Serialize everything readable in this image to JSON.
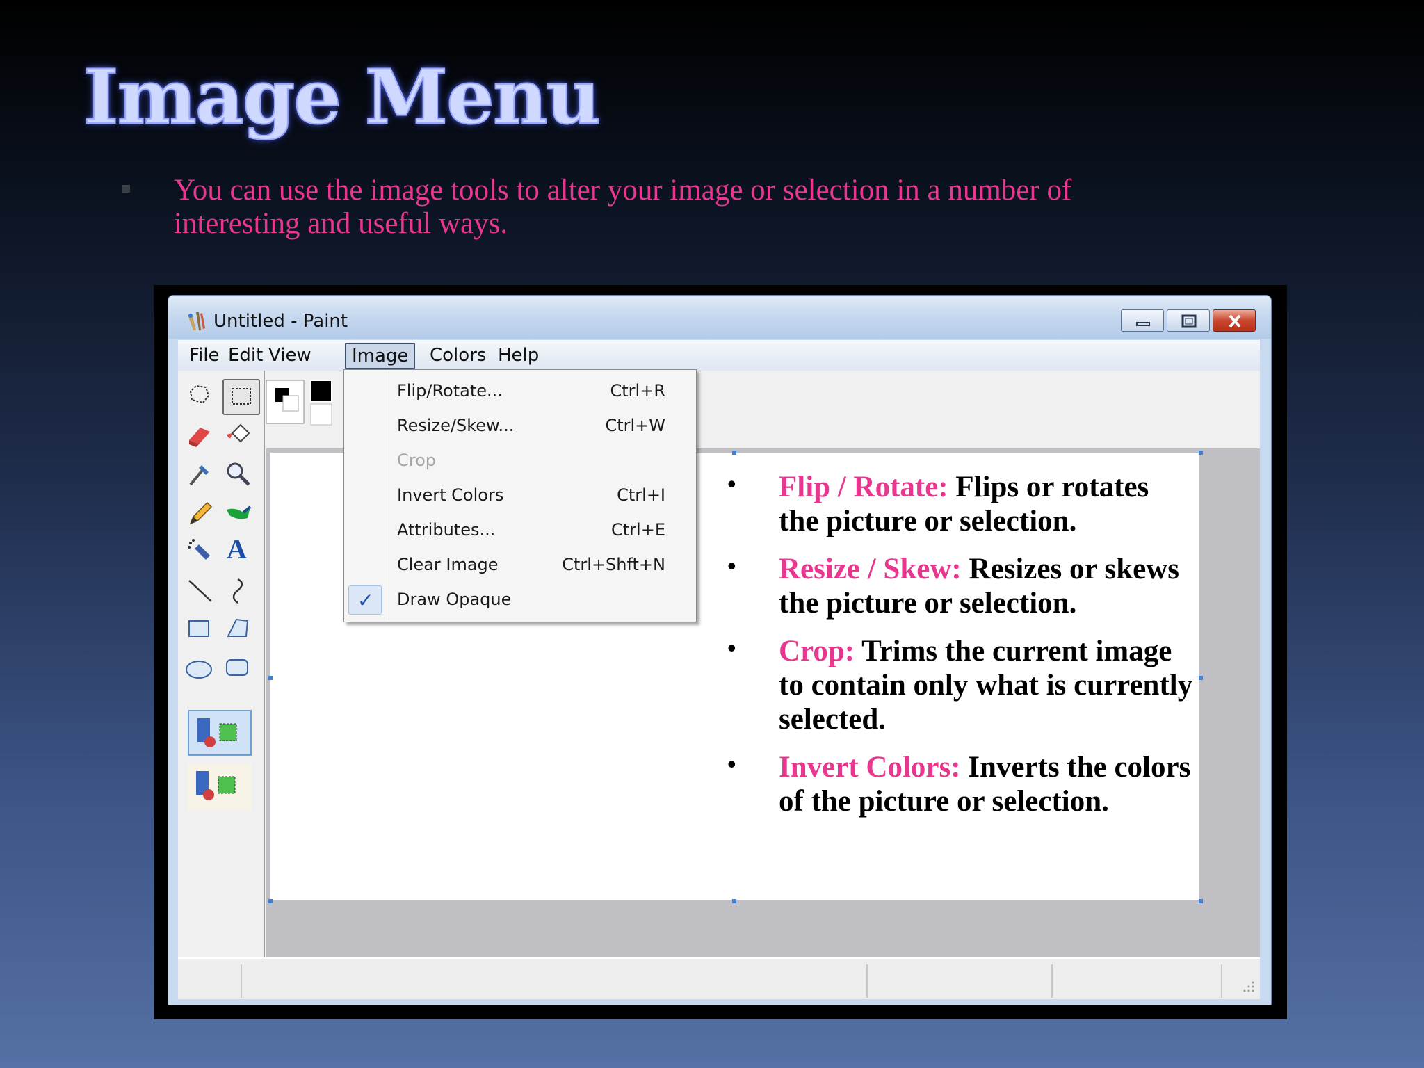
{
  "slide": {
    "title": "Image Menu",
    "intro": "You can use the image tools to alter your image or selection in a number of interesting and useful ways."
  },
  "window": {
    "title": "Untitled - Paint",
    "buttons": {
      "minimize": "minimize",
      "maximize": "maximize",
      "close": "close"
    }
  },
  "menubar": {
    "items": [
      {
        "label": "File"
      },
      {
        "label": "Edit"
      },
      {
        "label": "View"
      },
      {
        "label": "Image"
      },
      {
        "label": "Colors"
      },
      {
        "label": "Help"
      }
    ],
    "active": "Image"
  },
  "dropdown": {
    "items": [
      {
        "label": "Flip/Rotate...",
        "shortcut": "Ctrl+R",
        "enabled": true
      },
      {
        "label": "Resize/Skew...",
        "shortcut": "Ctrl+W",
        "enabled": true
      },
      {
        "label": "Crop",
        "shortcut": "",
        "enabled": false
      },
      {
        "label": "Invert Colors",
        "shortcut": "Ctrl+I",
        "enabled": true
      },
      {
        "label": "Attributes...",
        "shortcut": "Ctrl+E",
        "enabled": true
      },
      {
        "label": "Clear Image",
        "shortcut": "Ctrl+Shft+N",
        "enabled": true
      },
      {
        "label": "Draw Opaque",
        "shortcut": "",
        "enabled": true,
        "checked": true
      }
    ],
    "check_mark": "✓"
  },
  "tools": [
    "free-form-select",
    "rect-select",
    "eraser",
    "fill",
    "color-picker",
    "magnifier",
    "pencil",
    "brush",
    "airbrush",
    "text",
    "line",
    "curve",
    "rectangle",
    "polygon",
    "ellipse",
    "rounded-rectangle"
  ],
  "panel": {
    "bullet": "•",
    "items": [
      {
        "term": "Flip / Rotate:",
        "desc": " Flips or rotates the picture or selection."
      },
      {
        "term": "Resize / Skew:",
        "desc": " Resizes or skews the picture or selection."
      },
      {
        "term": "Crop:",
        "desc": " Trims the current image to contain only what is currently selected."
      },
      {
        "term": "Invert Colors:",
        "desc": " Inverts the colors of the picture or selection."
      }
    ]
  },
  "colors": {
    "accent": "#e8378f",
    "title_glow": "#9aa8ff"
  }
}
